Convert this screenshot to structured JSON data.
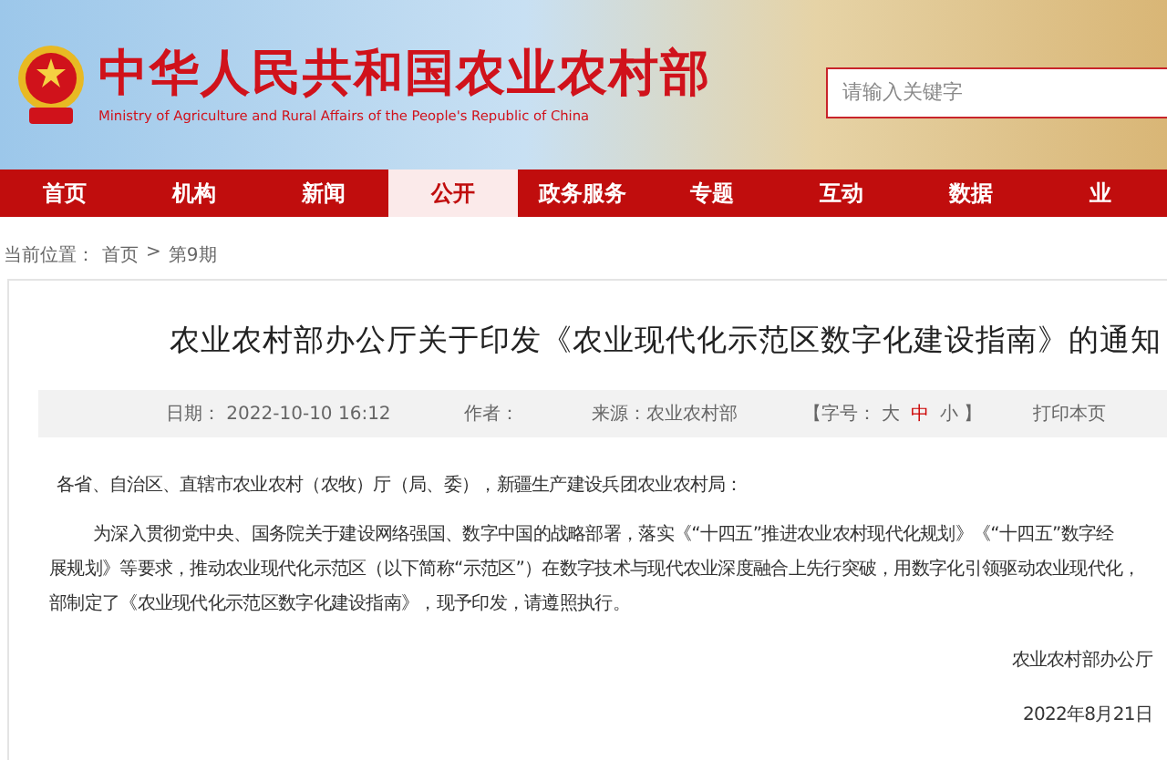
{
  "header": {
    "title": "中华人民共和国农业农村部",
    "subtitle": "Ministry of Agriculture and Rural Affairs of the People's Republic of China",
    "search": {
      "placeholder": "请输入关键字"
    }
  },
  "nav": [
    {
      "label": "首页",
      "selected": false
    },
    {
      "label": "机构",
      "selected": false
    },
    {
      "label": "新闻",
      "selected": false
    },
    {
      "label": "公开",
      "selected": true
    },
    {
      "label": "政务服务",
      "selected": false
    },
    {
      "label": "专题",
      "selected": false
    },
    {
      "label": "互动",
      "selected": false
    },
    {
      "label": "数据",
      "selected": false
    },
    {
      "label": "业",
      "selected": false
    }
  ],
  "breadcrumb": [
    "当前位置：",
    "首页",
    ">",
    "第9期"
  ],
  "article": {
    "title": "农业农村部办公厅关于印发《农业现代化示范区数字化建设指南》的通知",
    "meta": {
      "date": "日期： 2022-10-10 16:12",
      "author": "作者：",
      "source": "来源：农业农村部",
      "font_label": "【字号：",
      "font_sizes": [
        {
          "label": "大",
          "selected": false
        },
        {
          "label": "中",
          "selected": true
        },
        {
          "label": "小",
          "selected": false
        }
      ],
      "font_end": "】",
      "print": "打印本页"
    },
    "salutation": "各省、自治区、直辖市农业农村（农牧）厅（局、委），新疆生产建设兵团农业农村局：",
    "paragraph_lines": [
      "为深入贯彻党中央、国务院关于建设网络强国、数字中国的战略部署，落实《“十四五”推进农业农村现代化规划》《“十四五”数字经",
      "展规划》等要求，推动农业现代化示范区（以下简称“示范区”）在数字技术与现代农业深度融合上先行突破，用数字化引领驱动农业现代化，",
      "部制定了《农业现代化示范区数字化建设指南》，现予印发，请遵照执行。"
    ],
    "signature": "农业农村部办公厅",
    "sign_date": "2022年8月21日"
  }
}
